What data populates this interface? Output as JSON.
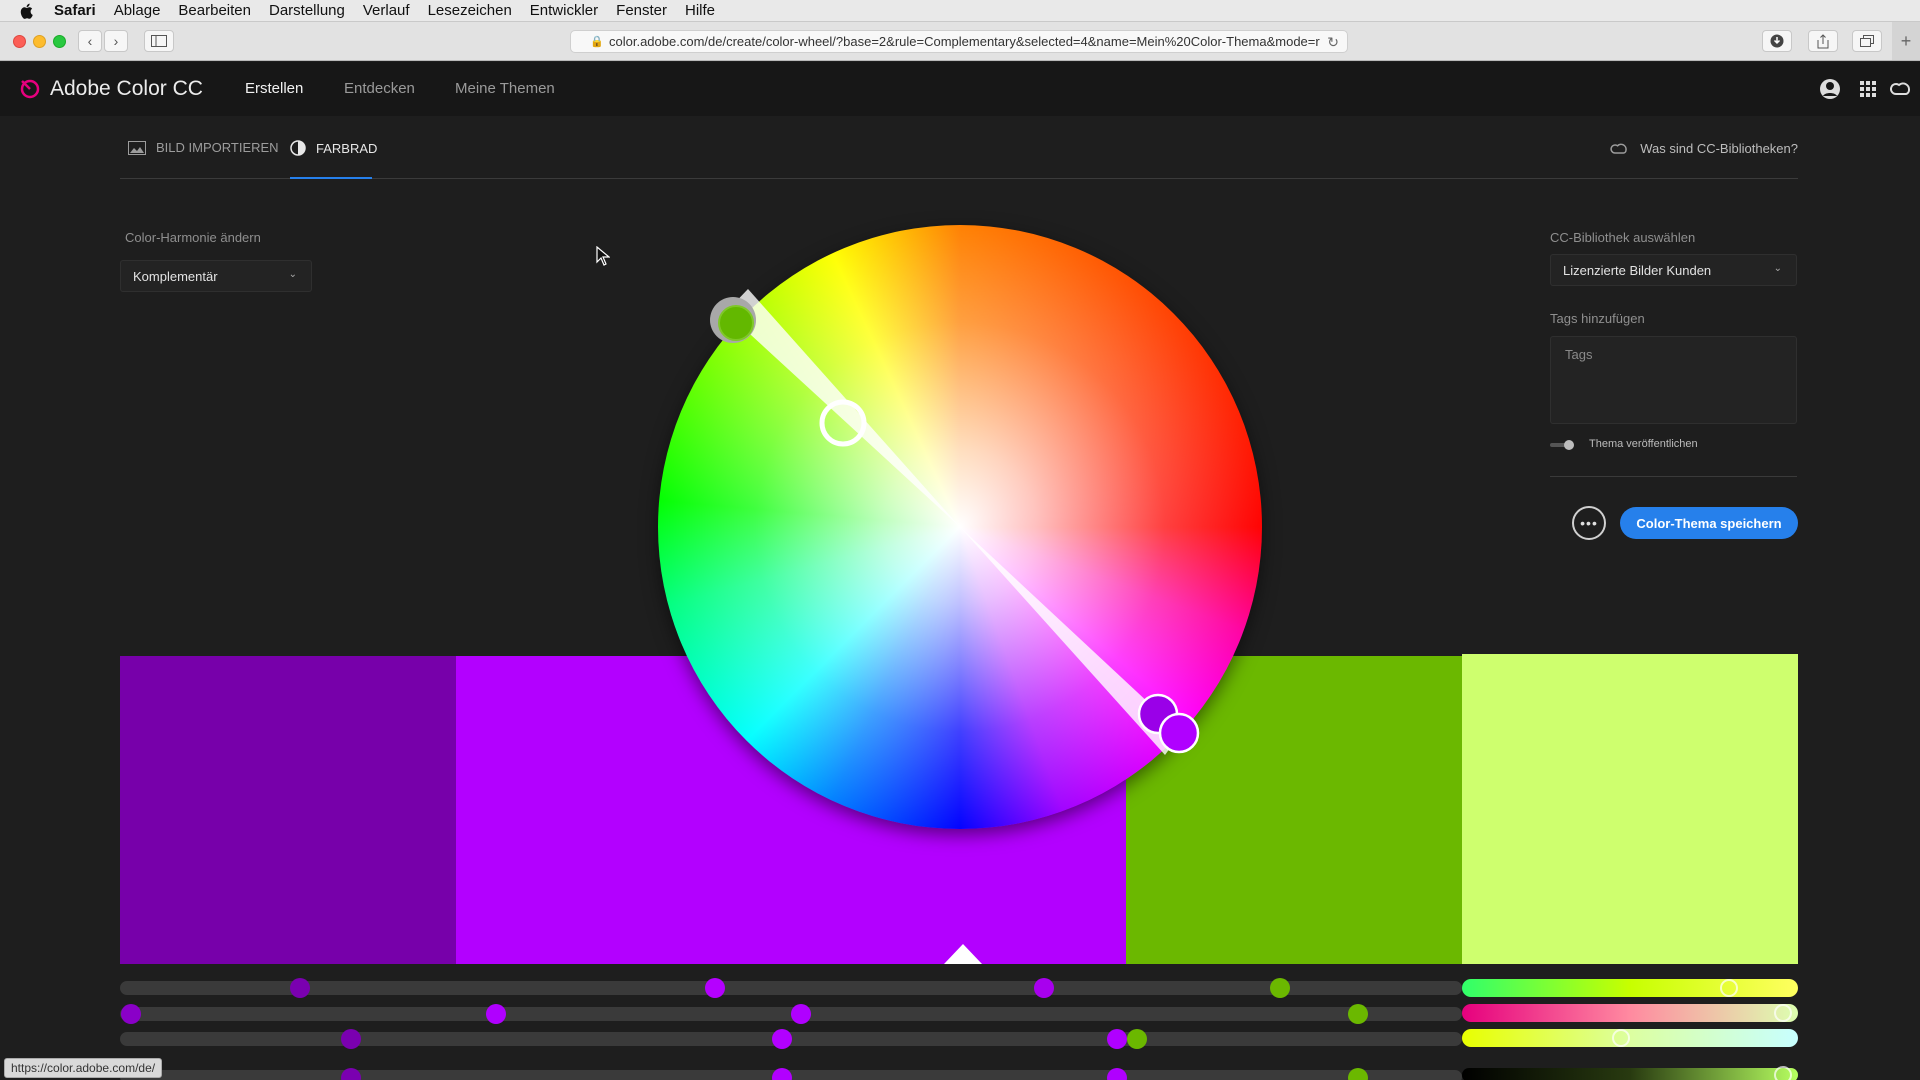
{
  "menubar": {
    "app": "Safari",
    "items": [
      "Ablage",
      "Bearbeiten",
      "Darstellung",
      "Verlauf",
      "Lesezeichen",
      "Entwickler",
      "Fenster",
      "Hilfe"
    ]
  },
  "browser": {
    "url": "color.adobe.com/de/create/color-wheel/?base=2&rule=Complementary&selected=4&name=Mein%20Color-Thema&mode=r",
    "status_url": "https://color.adobe.com/de/"
  },
  "header": {
    "brand": "Adobe Color CC",
    "nav": [
      "Erstellen",
      "Entdecken",
      "Meine Themen"
    ]
  },
  "subtabs": {
    "import_image": "BILD IMPORTIEREN",
    "color_wheel": "FARBRAD",
    "cc_help": "Was sind CC-Bibliotheken?"
  },
  "left": {
    "harmony_label": "Color-Harmonie ändern",
    "harmony_value": "Komplementär"
  },
  "right": {
    "library_label": "CC-Bibliothek auswählen",
    "library_value": "Lizenzierte Bilder Kunden",
    "tags_label": "Tags hinzufügen",
    "tags_placeholder": "Tags",
    "publish_label": "Thema veröffentlichen",
    "more_label": "•••",
    "save_label": "Color-Thema speichern"
  },
  "theme": {
    "selected_index": 4,
    "swatches": [
      "#7700aa",
      "#b300ff",
      "#b300ff",
      "#6bb800",
      "#ceff6e"
    ]
  },
  "colors": {
    "accent": "#2680eb",
    "background": "#1e1e1e",
    "header": "#171717"
  },
  "icons": [
    "apple-icon",
    "back-icon",
    "forward-icon",
    "sidebar-icon",
    "lock-icon",
    "reload-icon",
    "download-icon",
    "share-icon",
    "tabs-icon",
    "new-tab-icon",
    "adobe-color-logo-icon",
    "user-icon",
    "apps-grid-icon",
    "creative-cloud-icon",
    "image-icon",
    "color-wheel-icon",
    "chevron-down-icon"
  ]
}
